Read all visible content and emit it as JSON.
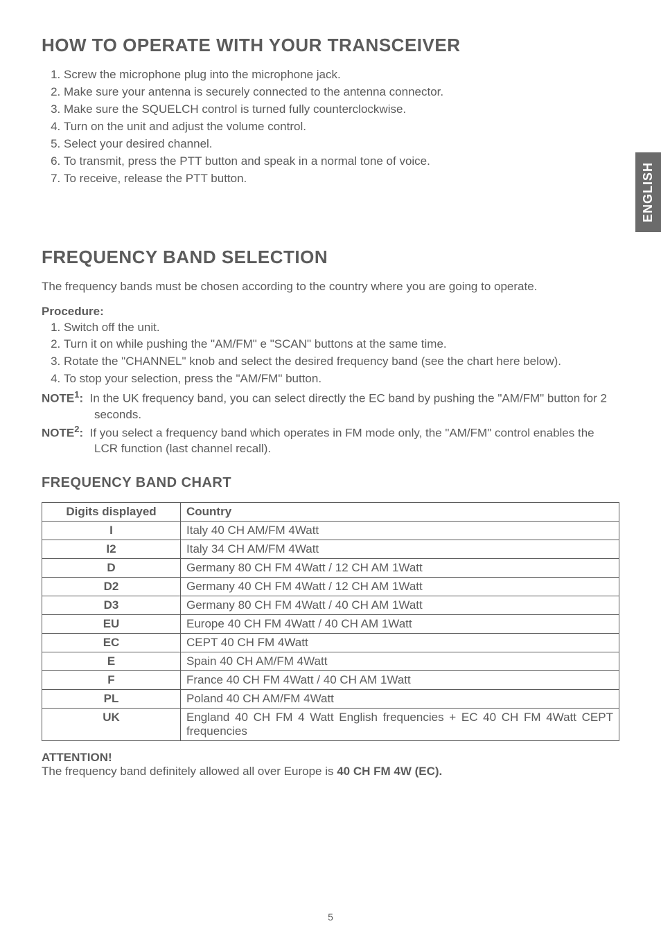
{
  "sideTab": "ENGLISH",
  "pageNumber": "5",
  "sections": {
    "operate": {
      "title": "HOW TO OPERATE WITH YOUR TRANSCEIVER",
      "steps": [
        "Screw the microphone plug into the microphone jack.",
        "Make sure your antenna is securely connected to the antenna connector.",
        "Make sure the SQUELCH control is turned fully counterclockwise.",
        "Turn on the unit and adjust the volume control.",
        "Select your desired channel.",
        "To transmit, press the PTT button and speak in a normal tone of voice.",
        "To receive, release the PTT button."
      ]
    },
    "freqsel": {
      "title": "FREQUENCY BAND SELECTION",
      "intro": "The frequency bands must be chosen according to the country where you are going to operate.",
      "procLabel": "Procedure:",
      "procSteps": [
        "Switch off the unit.",
        "Turn it on while pushing the \"AM/FM\" e \"SCAN\" buttons at the same time.",
        "Rotate the \"CHANNEL\" knob and select the desired frequency band (see the chart here below).",
        "To stop your selection, press the \"AM/FM\" button."
      ],
      "note1Label": "NOTE",
      "note1Sup": "1",
      "note1Colon": ":",
      "note1Text": "In the UK frequency band, you can select directly the EC band by pushing the \"AM/FM\" button for 2 seconds.",
      "note2Label": "NOTE",
      "note2Sup": "2",
      "note2Colon": ":",
      "note2Text": "If you select a frequency band which operates in FM mode only, the \"AM/FM\" control enables the LCR function (last channel recall)."
    },
    "chart": {
      "title": "FREQUENCY BAND CHART",
      "headers": {
        "col1": "Digits displayed",
        "col2": "Country"
      },
      "rows": [
        {
          "code": "I",
          "country": "Italy 40 CH AM/FM 4Watt"
        },
        {
          "code": "I2",
          "country": "Italy 34 CH AM/FM 4Watt"
        },
        {
          "code": "D",
          "country": "Germany 80 CH FM 4Watt / 12 CH AM 1Watt"
        },
        {
          "code": "D2",
          "country": "Germany 40 CH FM 4Watt / 12 CH AM 1Watt"
        },
        {
          "code": "D3",
          "country": "Germany 80 CH FM 4Watt / 40 CH AM 1Watt"
        },
        {
          "code": "EU",
          "country": "Europe 40 CH FM 4Watt / 40 CH AM 1Watt"
        },
        {
          "code": "EC",
          "country": "CEPT 40 CH FM 4Watt"
        },
        {
          "code": "E",
          "country": "Spain 40 CH AM/FM 4Watt"
        },
        {
          "code": "F",
          "country": "France 40 CH FM 4Watt / 40 CH AM 1Watt"
        },
        {
          "code": "PL",
          "country": "Poland 40 CH AM/FM 4Watt"
        },
        {
          "code": "UK",
          "country": "England 40 CH FM 4 Watt English frequencies + EC 40 CH FM 4Watt CEPT frequencies"
        }
      ]
    },
    "attention": {
      "label": "ATTENTION!",
      "textPrefix": "The frequency band definitely allowed all over Europe is ",
      "textBold": "40 CH FM 4W (EC)."
    }
  }
}
